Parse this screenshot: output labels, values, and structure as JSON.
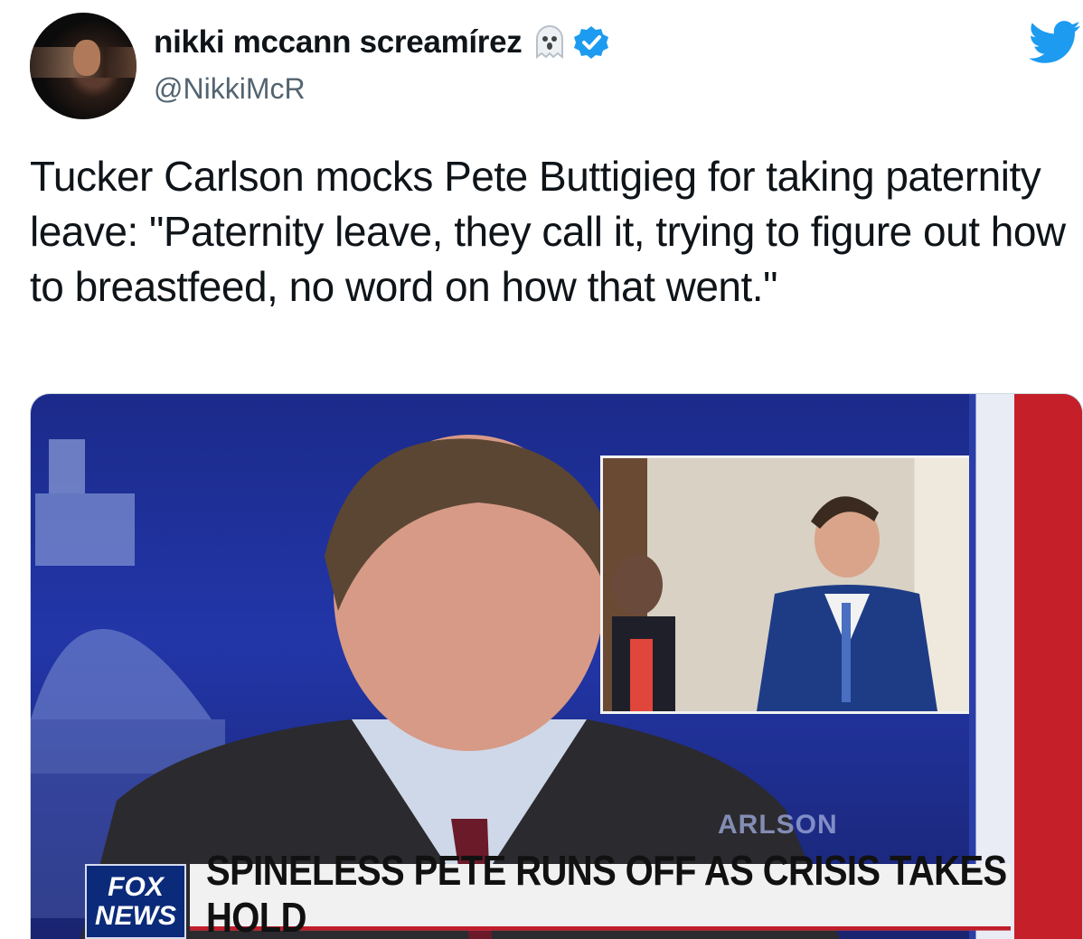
{
  "author": {
    "display_name": "nikki mccann screamírez",
    "handle": "@NikkiMcR",
    "name_icons": [
      "ghost-icon",
      "verified-badge-icon"
    ]
  },
  "brand_icon": "twitter-bird-icon",
  "tweet": {
    "text": "Tucker Carlson mocks Pete Buttigieg for taking paternity leave: \"Paternity leave, they call it, trying to figure out how to breastfeed, no word on how that went.\""
  },
  "media": {
    "logo_top": "FOX",
    "logo_bottom": "NEWS",
    "chyron": "SPINELESS PETE RUNS OFF AS CRISIS TAKES HOLD",
    "show_name_partial": "ARLSON"
  },
  "colors": {
    "verified": "#1d9bf0",
    "twitter_blue": "#1d9bf0",
    "text": "#0f1419",
    "handle": "#536471"
  }
}
